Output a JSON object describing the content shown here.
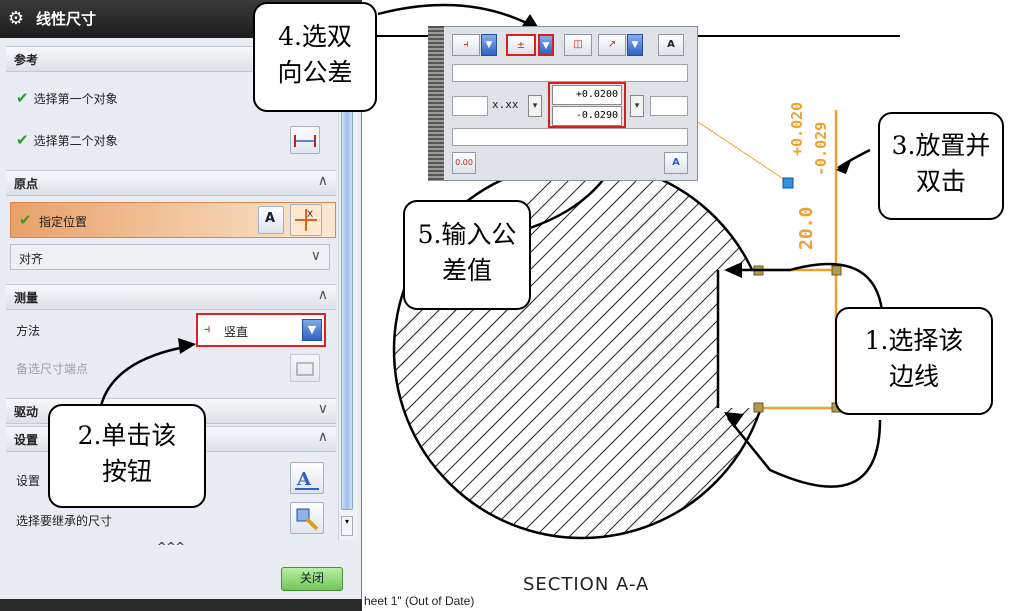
{
  "dialog": {
    "title": "线性尺寸",
    "sections": {
      "reference": {
        "label": "参考",
        "first_object": "选择第一个对象",
        "second_object": "选择第二个对象"
      },
      "origin": {
        "label": "原点",
        "specify_location": "指定位置",
        "align": "对齐"
      },
      "measurement": {
        "label": "测量",
        "method_label": "方法",
        "method_value": "竖直",
        "alt_endpoint": "备选尺寸端点"
      },
      "drive": {
        "label": "驱动"
      },
      "settings": {
        "label": "设置",
        "settings_item": "设置",
        "inherit_item": "选择要继承的尺寸"
      }
    },
    "expand_more": "^^^",
    "close_label": "关闭"
  },
  "toolbar": {
    "format_value": "x.xx",
    "upper_tolerance": "+0.0200",
    "lower_tolerance": "-0.0290",
    "text_btn_label": "A",
    "dec_btn_label": "0.00"
  },
  "drawing": {
    "dim_upper": "+0.020",
    "dim_lower": "-0.029",
    "dim_value": "20.0",
    "section_label": "SECTION A-A",
    "sheet_status": "heet 1\" (Out of Date)"
  },
  "callouts": {
    "c1": [
      "1.选择该",
      "边线"
    ],
    "c2": [
      "2.单击该",
      "按钮"
    ],
    "c3": [
      "3.放置并",
      "双击"
    ],
    "c4": [
      "4.选双",
      "向公差"
    ],
    "c5": [
      "5.输入公",
      "差值"
    ]
  },
  "colors": {
    "dimension": "#f0a030",
    "highlight": "#e02020",
    "accent_blue": "#2f62c4",
    "check_green": "#2aa02a"
  }
}
